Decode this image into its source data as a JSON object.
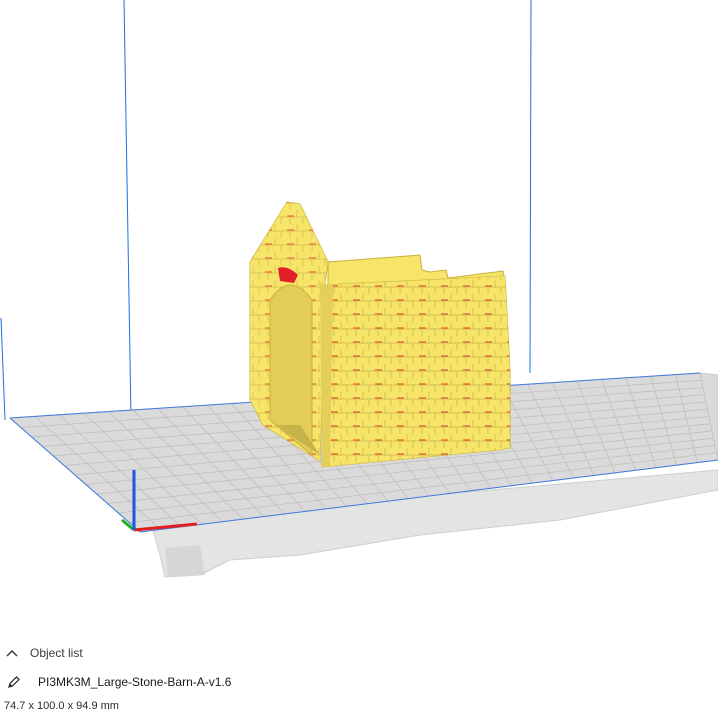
{
  "viewport": {
    "build_plate_color": "#dadada",
    "grid_line_color": "#bcbcbc",
    "volume_edge_color": "#1f6fe0",
    "model_color": "#f7e56a",
    "overhang_color": "#e0202a",
    "axis_colors": {
      "x": "#e02020",
      "y": "#22aa22",
      "z": "#1f55e0"
    }
  },
  "object_panel": {
    "header_label": "Object list",
    "header_icon": "chevron-up-icon",
    "edit_icon": "pencil-icon",
    "object_name": "PI3MK3M_Large-Stone-Barn-A-v1.6",
    "dimensions": "74.7 x 100.0 x 94.9 mm"
  }
}
